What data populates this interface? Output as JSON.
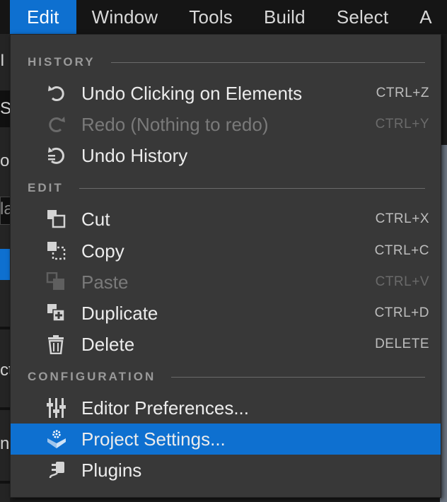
{
  "menubar": {
    "items": [
      {
        "label": "Edit"
      },
      {
        "label": "Window"
      },
      {
        "label": "Tools"
      },
      {
        "label": "Build"
      },
      {
        "label": "Select"
      },
      {
        "label": "A"
      }
    ]
  },
  "background": {
    "fragments": [
      "I",
      "S",
      "or",
      "la",
      "cto",
      "na"
    ]
  },
  "dropdown": {
    "sections": [
      {
        "title": "HISTORY"
      },
      {
        "title": "EDIT"
      },
      {
        "title": "CONFIGURATION"
      }
    ],
    "items": [
      {
        "label": "Undo Clicking on Elements",
        "shortcut": "CTRL+Z",
        "icon": "undo-icon",
        "enabled": true
      },
      {
        "label": "Redo (Nothing to redo)",
        "shortcut": "CTRL+Y",
        "icon": "redo-icon",
        "enabled": false
      },
      {
        "label": "Undo History",
        "shortcut": "",
        "icon": "undo-history-icon",
        "enabled": true
      },
      {
        "label": "Cut",
        "shortcut": "CTRL+X",
        "icon": "cut-icon",
        "enabled": true
      },
      {
        "label": "Copy",
        "shortcut": "CTRL+C",
        "icon": "copy-icon",
        "enabled": true
      },
      {
        "label": "Paste",
        "shortcut": "CTRL+V",
        "icon": "paste-icon",
        "enabled": false
      },
      {
        "label": "Duplicate",
        "shortcut": "CTRL+D",
        "icon": "duplicate-icon",
        "enabled": true
      },
      {
        "label": "Delete",
        "shortcut": "DELETE",
        "icon": "trash-icon",
        "enabled": true
      },
      {
        "label": "Editor Preferences...",
        "shortcut": "",
        "icon": "sliders-icon",
        "enabled": true
      },
      {
        "label": "Project Settings...",
        "shortcut": "",
        "icon": "project-settings-icon",
        "enabled": true,
        "selected": true
      },
      {
        "label": "Plugins",
        "shortcut": "",
        "icon": "plugin-icon",
        "enabled": true
      }
    ]
  },
  "colors": {
    "accent": "#0e70d0",
    "menu_bg": "#383838",
    "bar_bg": "#151515"
  }
}
